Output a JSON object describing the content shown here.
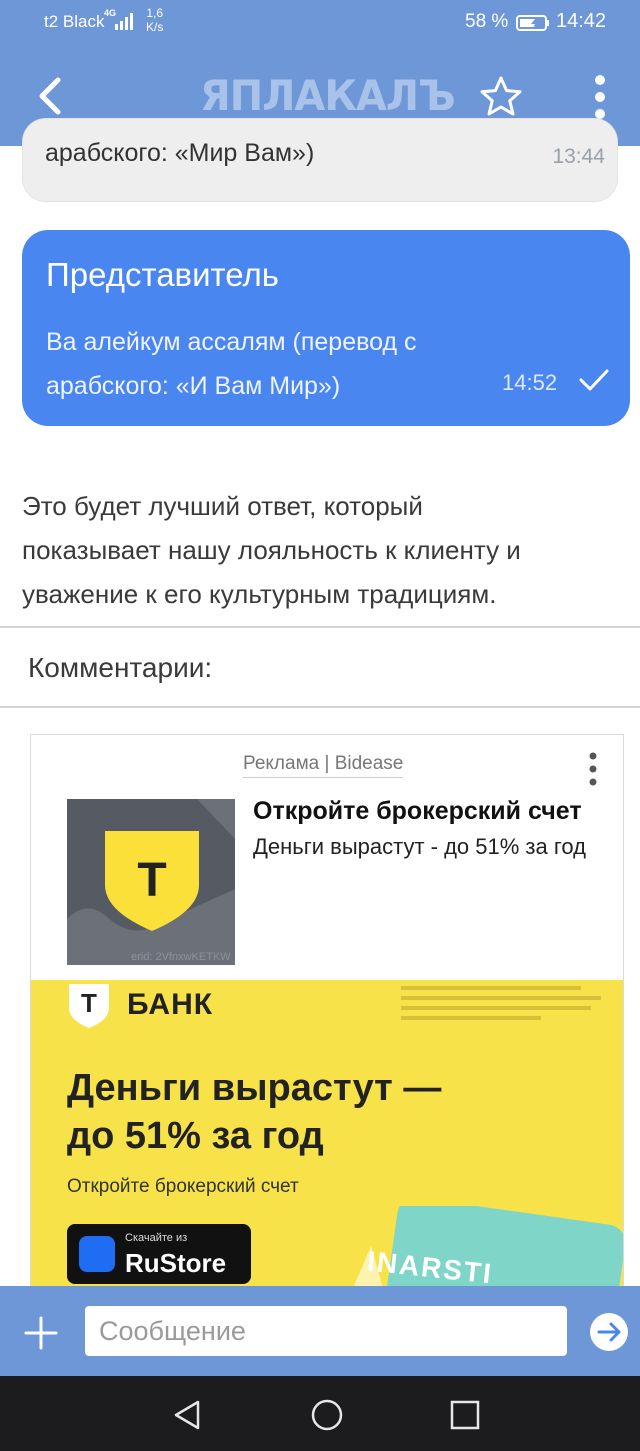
{
  "status_bar": {
    "carrier": "t2 Black",
    "network": "4G",
    "speed_value": "1,6",
    "speed_unit": "K/s",
    "battery_percent": "58 %",
    "time": "14:42"
  },
  "header": {
    "logo_text": "ЯПЛАКАЛЪ",
    "back_icon": "chevron-left-icon",
    "favorite_icon": "star-outline-icon",
    "menu_icon": "more-vertical-icon"
  },
  "messages": {
    "incoming": {
      "text": "арабского: «Мир Вам»)",
      "time": "13:44"
    },
    "outgoing": {
      "sender": "Представитель",
      "lines": [
        "Ва алейкум ассалям (перевод с",
        "арабского: «И Вам Мир»)"
      ],
      "time": "14:52",
      "status_icon": "check-icon"
    }
  },
  "post": {
    "lines": [
      "Это будет лучший ответ, который",
      "показывает нашу лояльность к клиенту и",
      "уважение к его культурным традициям."
    ]
  },
  "comments": {
    "title": "Комментарии:"
  },
  "ad": {
    "source": "Реклама | Bidease",
    "title": "Откройте брокерский счет",
    "description": "Деньги вырастут - до 51% за год",
    "thumb_letter": "Т",
    "erid": "erid: 2VfnxwKETKW",
    "banner": {
      "logo_letter": "Т",
      "brand": "БАНК",
      "headline_1": "Деньги вырастут —",
      "headline_2": "до 51% за год",
      "cta": "Откройте брокерский счет",
      "store_small": "Скачайте из",
      "store_big": "RuStore",
      "card_text": "INARSTI"
    },
    "colors": {
      "yellow": "#f7e24a",
      "shield": "#fbe03a"
    }
  },
  "composer": {
    "placeholder": "Сообщение",
    "add_icon": "plus-icon",
    "send_icon": "arrow-right-circle-icon"
  },
  "nav": {
    "back_icon": "triangle-back-icon",
    "home_icon": "circle-home-icon",
    "recents_icon": "square-recents-icon"
  },
  "colors": {
    "header_blue": "#6e97d8",
    "outgoing_bubble": "#4a86f0",
    "incoming_bubble": "#eeeeee"
  }
}
